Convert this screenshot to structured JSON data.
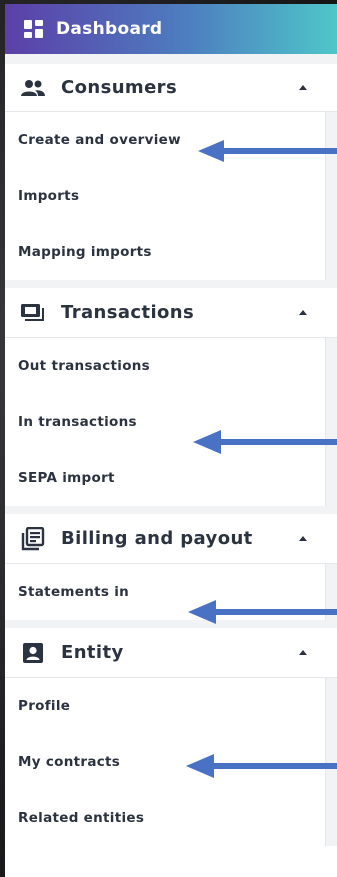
{
  "dashboard": {
    "label": "Dashboard",
    "icon": "dashboard-grid-icon"
  },
  "sections": [
    {
      "label": "Consumers",
      "icon": "people-icon",
      "items": [
        "Create and overview",
        "Imports",
        "Mapping imports"
      ]
    },
    {
      "label": "Transactions",
      "icon": "transactions-icon",
      "items": [
        "Out transactions",
        "In transactions",
        "SEPA import"
      ]
    },
    {
      "label": "Billing and payout",
      "icon": "receipt-icon",
      "items": [
        "Statements in"
      ]
    },
    {
      "label": "Entity",
      "icon": "contact-card-icon",
      "items": [
        "Profile",
        "My contracts",
        "Related entities"
      ]
    }
  ],
  "colors": {
    "gradient_start": "#5c3fa8",
    "gradient_end": "#4fc6c9",
    "text": "#2c3340",
    "arrow": "#4a72c4"
  },
  "annotations": {
    "arrow_targets": [
      "Create and overview",
      "In transactions",
      "Statements in",
      "My contracts"
    ]
  }
}
